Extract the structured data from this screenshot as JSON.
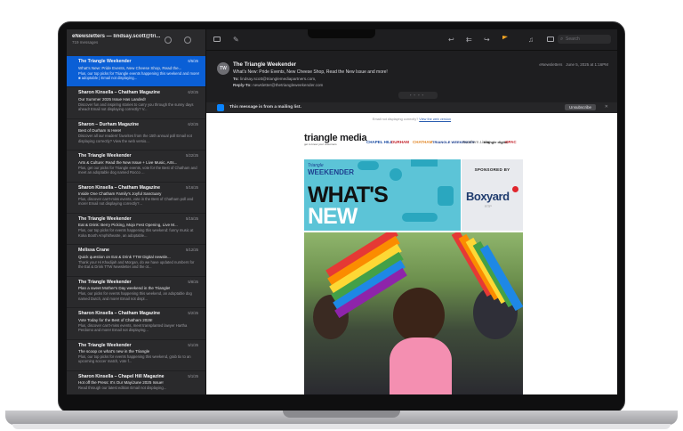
{
  "sidebar": {
    "mailbox_title": "eNewsletters — lindsay.scott@tri...",
    "message_count": "719 messages",
    "messages": [
      {
        "from": "The Triangle Weekender",
        "date": "6/5/25",
        "subject": "What's New: Pride Events, New Cheese Shop, Read the...",
        "preview": "Plus, our top picks for Triangle events happening this weekend and more! ■ adoptable | Email not displaying..."
      },
      {
        "from": "Sharon Kinsella – Chatham Magazine",
        "date": "6/2/25",
        "subject": "Our Summer 2025 Issue Has Landed!",
        "preview": "Discover fun and inspiring stories to carry you through the sunny days ahead! Email not displaying correctly? V..."
      },
      {
        "from": "Sharon – Durham Magazine",
        "date": "6/2/25",
        "subject": "Best of Durham Is Here!",
        "preview": "Discover all our readers' favorites from the 15th annual poll Email not displaying correctly? View the web versio..."
      },
      {
        "from": "The Triangle Weekender",
        "date": "5/22/25",
        "subject": "Arts & Culture: Read the New Issue + Live Music, Arts...",
        "preview": "Plus, get our picks for Triangle events, vote for the Best of Chatham and meet an adoptable dog named Rocco ..."
      },
      {
        "from": "Sharon Kinsella – Chatham Magazine",
        "date": "5/16/25",
        "subject": "Inside One Chatham Family's Joyful Sanctuary",
        "preview": "Plus, discover can't-miss events, vote in the Best of Chatham poll and more! Email not displaying correctly?..."
      },
      {
        "from": "The Triangle Weekender",
        "date": "5/15/25",
        "subject": "Eat & Drink: Berry Picking, Mojo Fest Opening, Live M...",
        "preview": "Plus, our top picks for events happening this weekend: funny music at Koka Booth Amphitheatre, an adoptable..."
      },
      {
        "from": "Melissa Crane",
        "date": "5/12/25",
        "subject": "Quick question on Eat & Drink TTW Digital newsle...",
        "preview": "Thank you! Hi Khadijah and Morgan, do we have updated numbers for the Eat & Drink TTW Newsletter and the ot..."
      },
      {
        "from": "The Triangle Weekender",
        "date": "5/8/25",
        "subject": "Plan a sweet Mother's Day weekend in the Triangle!",
        "preview": "Plus, our picks for events happening this weekend, an adoptable dog named Dutch, and more! Email not displ..."
      },
      {
        "from": "Sharon Kinsella – Chatham Magazine",
        "date": "5/2/25",
        "subject": "Vote Today for the Best of Chatham 2026!",
        "preview": "Plus, discover can't-miss events, meet transplanted lawyer Hartha Perdomo and more! Email not displaying..."
      },
      {
        "from": "The Triangle Weekender",
        "date": "5/1/25",
        "subject": "The scoop on what's new in the Triangle",
        "preview": "Plus, our top picks for events happening this weekend, grab tix to an upcoming soccer match, vote f..."
      },
      {
        "from": "Sharon Kinsella – Chapel Hill Magazine",
        "date": "5/1/25",
        "subject": "Hot off the Press: It's Our May/June 2025 Issue!",
        "preview": "Read through our latest edition Email not displaying..."
      }
    ]
  },
  "toolbar": {
    "search_placeholder": "Search"
  },
  "message": {
    "avatar_initials": "TW",
    "from": "The Triangle Weekender",
    "subject": "What's New: Pride Events, New Cheese Shop, Read the New Issue and more!",
    "to_label": "To:",
    "to": "lindsay.scott@trianglemediapartners.com,",
    "reply_label": "Reply-To:",
    "reply_to": "newsletter@thetriangleweekender.com",
    "mailbox": "eNewsletters",
    "date": "June 5, 2025 at 1:16PM"
  },
  "banner": {
    "text": "This message is from a mailing list.",
    "unsubscribe": "Unsubscribe"
  },
  "newsletter": {
    "web_prefix": "Email not displaying correctly?",
    "web_link": "View the web version",
    "logo_main": "triangle media",
    "logo_tag": "get to know your customers",
    "partner_logos": [
      "CHAPEL HILL",
      "DURHAM",
      "CHATHAM",
      "TRIANGLE WEEKENDER",
      "Southern Living",
      "triangle digital",
      "OPAC"
    ],
    "hero_brand_top": "Triangle",
    "hero_brand": "WEEKENDER",
    "hero_line1": "WHAT'S",
    "hero_line2": "NEW",
    "sponsor_label": "SPONSORED BY",
    "sponsor_name": "Boxyard",
    "sponsor_sub": "RTP"
  },
  "colors": {
    "selection": "#0a5fd6",
    "hero_teal": "#5cc4d7",
    "flag": "#f5a623"
  },
  "icons": [
    "filter-icon",
    "compose-icon",
    "envelope-icon",
    "reply-icon",
    "reply-all-icon",
    "forward-icon",
    "flag-icon",
    "bell-icon",
    "folder-icon",
    "search-icon",
    "info-icon",
    "close-icon"
  ]
}
